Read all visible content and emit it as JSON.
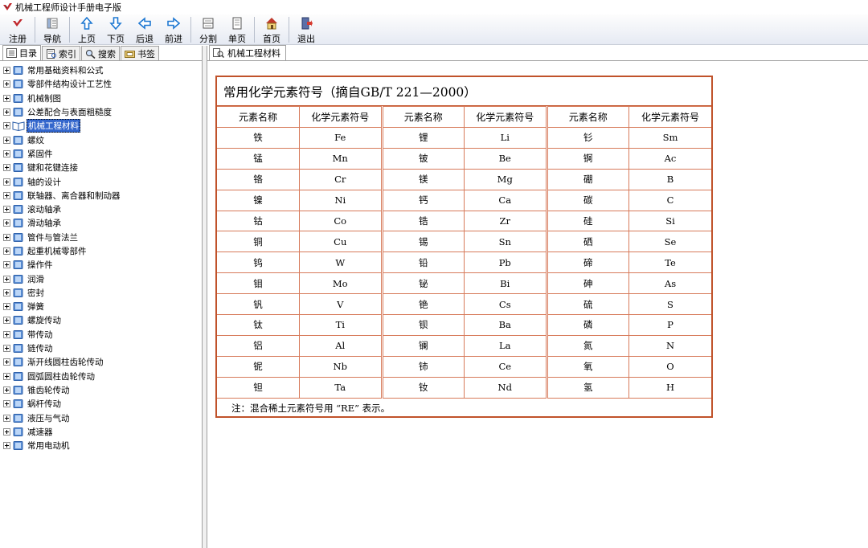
{
  "window": {
    "title": "机械工程师设计手册电子版"
  },
  "toolbar": {
    "buttons": [
      {
        "label": "注册",
        "icon": "register-icon"
      },
      {
        "label": "导航",
        "icon": "navigation-icon"
      },
      {
        "label": "上页",
        "icon": "arrow-up-icon"
      },
      {
        "label": "下页",
        "icon": "arrow-down-icon"
      },
      {
        "label": "后退",
        "icon": "arrow-left-icon"
      },
      {
        "label": "前进",
        "icon": "arrow-right-icon"
      },
      {
        "label": "分割",
        "icon": "split-icon"
      },
      {
        "label": "单页",
        "icon": "single-page-icon"
      },
      {
        "label": "首页",
        "icon": "home-icon"
      },
      {
        "label": "退出",
        "icon": "exit-icon"
      }
    ]
  },
  "left_tabs": [
    {
      "label": "目录",
      "icon": "contents-icon",
      "active": true
    },
    {
      "label": "索引",
      "icon": "index-icon",
      "active": false
    },
    {
      "label": "搜索",
      "icon": "search-icon",
      "active": false
    },
    {
      "label": "书签",
      "icon": "bookmark-icon",
      "active": false
    }
  ],
  "tree": {
    "selected_index": 4,
    "items": [
      "常用基础资料和公式",
      "零部件结构设计工艺性",
      "机械制图",
      "公差配合与表面粗糙度",
      "机械工程材料",
      "螺纹",
      "紧固件",
      "键和花键连接",
      "轴的设计",
      "联轴器、离合器和制动器",
      "滚动轴承",
      "滑动轴承",
      "管件与管法兰",
      "起重机械零部件",
      "操作件",
      "润滑",
      "密封",
      "弹簧",
      "螺旋传动",
      "带传动",
      "链传动",
      "渐开线圆柱齿轮传动",
      "圆弧圆柱齿轮传动",
      "锥齿轮传动",
      "蜗杆传动",
      "液压与气动",
      "减速器",
      "常用电动机"
    ]
  },
  "right_tab": {
    "label": "机械工程材料",
    "icon": "document-icon"
  },
  "document": {
    "title": "常用化学元素符号（摘自GB/T 221—2000）",
    "headers": [
      "元素名称",
      "化学元素符号",
      "元素名称",
      "化学元素符号",
      "元素名称",
      "化学元素符号"
    ],
    "rows": [
      [
        "铁",
        "Fe",
        "锂",
        "Li",
        "钐",
        "Sm"
      ],
      [
        "锰",
        "Mn",
        "铍",
        "Be",
        "锕",
        "Ac"
      ],
      [
        "铬",
        "Cr",
        "镁",
        "Mg",
        "硼",
        "B"
      ],
      [
        "镍",
        "Ni",
        "钙",
        "Ca",
        "碳",
        "C"
      ],
      [
        "钴",
        "Co",
        "锆",
        "Zr",
        "硅",
        "Si"
      ],
      [
        "铜",
        "Cu",
        "锡",
        "Sn",
        "硒",
        "Se"
      ],
      [
        "钨",
        "W",
        "铅",
        "Pb",
        "碲",
        "Te"
      ],
      [
        "钼",
        "Mo",
        "铋",
        "Bi",
        "砷",
        "As"
      ],
      [
        "钒",
        "V",
        "铯",
        "Cs",
        "硫",
        "S"
      ],
      [
        "钛",
        "Ti",
        "钡",
        "Ba",
        "磷",
        "P"
      ],
      [
        "铝",
        "Al",
        "镧",
        "La",
        "氮",
        "N"
      ],
      [
        "铌",
        "Nb",
        "铈",
        "Ce",
        "氧",
        "O"
      ],
      [
        "钽",
        "Ta",
        "钕",
        "Nd",
        "氢",
        "H"
      ]
    ],
    "note": "注：混合稀土元素符号用 “RE” 表示。"
  },
  "colors": {
    "table_border": "#c0522a",
    "selection": "#3366cc",
    "toolbar_arrow": "#1e78d2"
  }
}
